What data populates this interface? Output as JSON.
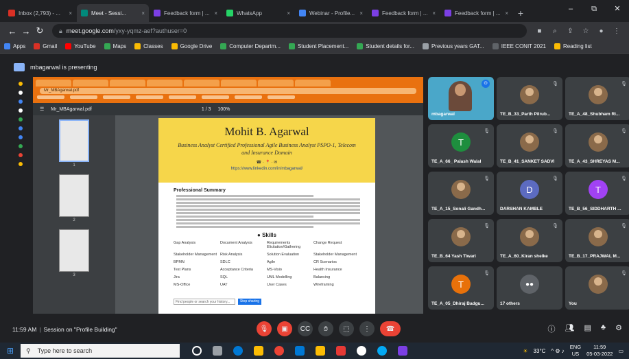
{
  "browser": {
    "tabs": [
      {
        "label": "Inbox (2,793) - ...",
        "color": "#d93025"
      },
      {
        "label": "Meet - Sessi...",
        "color": "#00897b",
        "active": true
      },
      {
        "label": "Feedback form | ...",
        "color": "#7b3fe4"
      },
      {
        "label": "WhatsApp",
        "color": "#25d366"
      },
      {
        "label": "Webinar - Profile...",
        "color": "#4285f4"
      },
      {
        "label": "Feedback form | ...",
        "color": "#7b3fe4"
      },
      {
        "label": "Feedback form | ...",
        "color": "#7b3fe4"
      }
    ],
    "new_tab": "+",
    "win_minimize": "–",
    "win_restore": "⧉",
    "win_close": "✕",
    "url_host": "meet.google.com",
    "url_path": "/yxy-yqmz-aef?authuser=0",
    "bookmarks": [
      {
        "label": "Apps",
        "color": "#4285f4"
      },
      {
        "label": "Gmail",
        "color": "#d93025"
      },
      {
        "label": "YouTube",
        "color": "#ff0000"
      },
      {
        "label": "Maps",
        "color": "#34a853"
      },
      {
        "label": "Classes",
        "color": "#fbbc04"
      },
      {
        "label": "Google Drive",
        "color": "#fbbc04"
      },
      {
        "label": "Computer Departm...",
        "color": "#34a853"
      },
      {
        "label": "Student Placement...",
        "color": "#34a853"
      },
      {
        "label": "Student details for...",
        "color": "#34a853"
      },
      {
        "label": "Previous years GAT...",
        "color": "#9aa0a6"
      },
      {
        "label": "IEEE CONIT 2021",
        "color": "#5f6368"
      },
      {
        "label": "Reading list",
        "color": "#fbbc04"
      }
    ]
  },
  "meet": {
    "presenting_text": "mbagarwal is presenting",
    "accent_color": "#1a73e8",
    "shared_doc": {
      "file_name": "Mr_MBAgarwal.pdf",
      "page_indicator": "1 / 3",
      "zoom": "100%",
      "name": "Mohit B. Agarwal",
      "title": "Business Analyst Certified Professional Agile Business Analyst PSPO-1, Telecom and Insurance Domain",
      "link": "https://www.linkedin.com/in/mbagarwal/",
      "summary_heading": "Professional Summary",
      "skills_heading": "Skills",
      "skills": [
        "Gap Analysis",
        "Stakeholder Management",
        "BPMN",
        "Test Plans",
        "Jira",
        "MS-Office",
        "Document Analysis",
        "Risk Analysis",
        "SDLC",
        "Acceptance Criteria",
        "SQL",
        "UAT",
        "Requirements Elicitation/Gathering",
        "Solution Evaluation",
        "Agile",
        "MS-Visio",
        "UML Modelling",
        "User Cases",
        "Change Request",
        "Stakeholder Management",
        "CR Scenarios",
        "Health Insurance",
        "Balancing",
        "Wireframing"
      ],
      "find_placeholder": "Find people or search your history...",
      "find_button": "Stop sharing"
    },
    "participants": [
      {
        "name": "mbagarwal",
        "type": "speaker"
      },
      {
        "name": "TE_B_33_Parth Pilrub...",
        "type": "photo"
      },
      {
        "name": "TE_A_48_Shubham Ri...",
        "type": "photo"
      },
      {
        "name": "TE_A_66_ Palash Walal",
        "type": "letter",
        "letter": "T",
        "color": "#1e8e3e"
      },
      {
        "name": "TE_B_41_SANKET SADVI",
        "type": "photo"
      },
      {
        "name": "TE_A_43_SHREYAS M...",
        "type": "photo"
      },
      {
        "name": "TE_A_15_Sonali Gandh...",
        "type": "photo"
      },
      {
        "name": "DARSHAN KAMBLE",
        "type": "letter",
        "letter": "D",
        "color": "#5c6bc0"
      },
      {
        "name": "TE_B_56_SIDDHARTH ...",
        "type": "letter",
        "letter": "T",
        "color": "#a142f4"
      },
      {
        "name": "TE_B_64 Yash Tiwari",
        "type": "photo"
      },
      {
        "name": "TE_A_60_Kiran shelke",
        "type": "photo"
      },
      {
        "name": "TE_B_17_PRAJWAL M...",
        "type": "photo"
      },
      {
        "name": "TE_A_05_Dhiraj Badgu...",
        "type": "letter",
        "letter": "T",
        "color": "#e8710a"
      },
      {
        "name": "17 others",
        "type": "group"
      },
      {
        "name": "You",
        "type": "photo"
      }
    ],
    "footer_time": "11:59 AM",
    "footer_session": "Session on \"Profile Building\""
  },
  "taskbar": {
    "search_placeholder": "Type here to search",
    "weather": "33°C",
    "lang": "ENG",
    "region": "US",
    "time": "11:59",
    "date": "05-03-2022"
  }
}
